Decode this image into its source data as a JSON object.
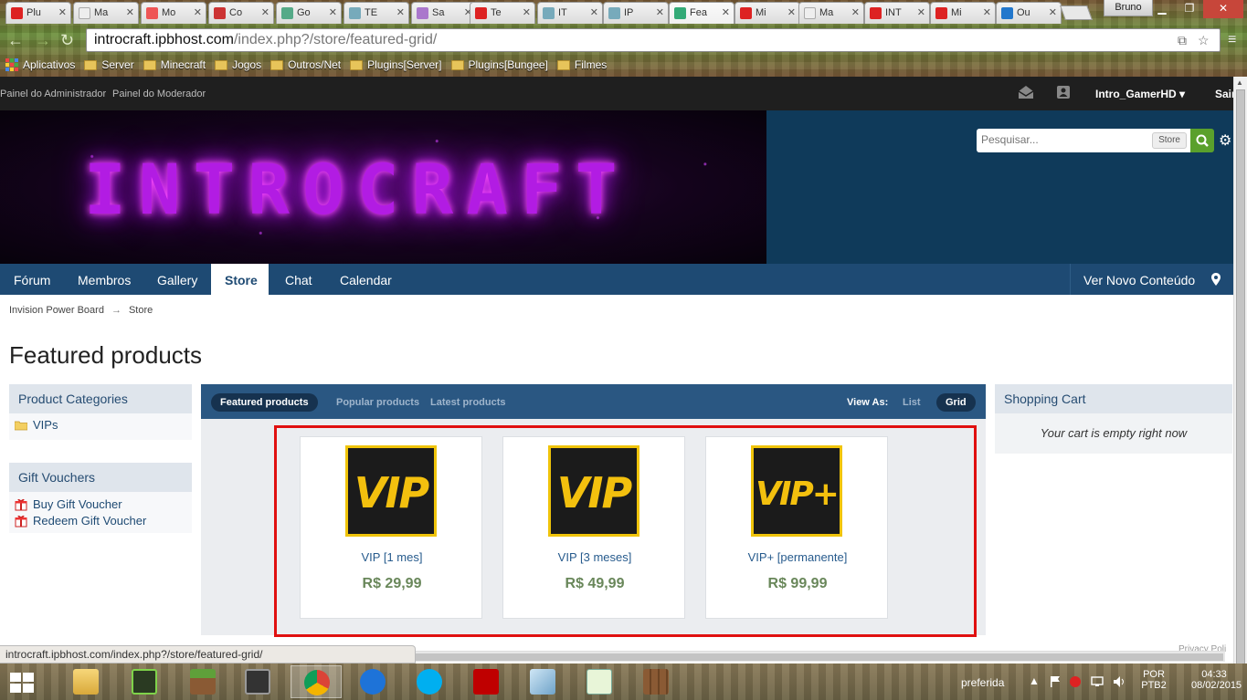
{
  "browser": {
    "tabs": [
      {
        "label": "Plu",
        "color": "#d22"
      },
      {
        "label": "Ma",
        "color": "#ddd"
      },
      {
        "label": "Mo",
        "color": "#e55"
      },
      {
        "label": "Co",
        "color": "#c33"
      },
      {
        "label": "Go",
        "color": "#5a8"
      },
      {
        "label": "TE",
        "color": "#7ab"
      },
      {
        "label": "Sa",
        "color": "#a7c"
      },
      {
        "label": "Te",
        "color": "#d22"
      },
      {
        "label": "IT",
        "color": "#7ab"
      },
      {
        "label": "IP",
        "color": "#7ab"
      },
      {
        "label": "Fea",
        "color": "#3a7"
      },
      {
        "label": "Mi",
        "color": "#d22"
      },
      {
        "label": "Ma",
        "color": "#ddd"
      },
      {
        "label": "INT",
        "color": "#d22"
      },
      {
        "label": "Mi",
        "color": "#d22"
      },
      {
        "label": "Ou",
        "color": "#27c"
      }
    ],
    "user": "Bruno",
    "url_host": "introcraft.ipbhost.com",
    "url_path": "/index.php?/store/featured-grid/",
    "bookmarks": [
      "Aplicativos",
      "Server",
      "Minecraft",
      "Jogos",
      "Outros/Net",
      "Plugins[Server]",
      "Plugins[Bungee]",
      "Filmes"
    ],
    "status_url": "introcraft.ipbhost.com/index.php?/store/featured-grid/"
  },
  "admin_bar": {
    "admin_panel": "Painel do Administrador",
    "mod_panel": "Painel do Moderador",
    "username": "Intro_GamerHD",
    "signout": "Sair"
  },
  "banner": {
    "logo_text": "INTROCRAFT",
    "search_placeholder": "Pesquisar...",
    "search_scope": "Store"
  },
  "nav": {
    "items": [
      "Fórum",
      "Membros",
      "Gallery",
      "Store",
      "Chat",
      "Calendar"
    ],
    "active": "Store",
    "new_content": "Ver Novo Conteúdo"
  },
  "breadcrumb": {
    "root": "Invision Power Board",
    "arrow": "→",
    "current": "Store"
  },
  "page_title": "Featured products",
  "sidebar": {
    "categories_title": "Product Categories",
    "categories": [
      "VIPs"
    ],
    "vouchers_title": "Gift Vouchers",
    "vouchers": [
      "Buy Gift Voucher",
      "Redeem Gift Voucher"
    ]
  },
  "products_panel": {
    "tabs": [
      "Featured products",
      "Popular products",
      "Latest products"
    ],
    "view_as": "View As:",
    "view_list": "List",
    "view_grid": "Grid",
    "items": [
      {
        "image_text": "VIP",
        "name": "VIP [1 mes]",
        "price": "R$ 29,99"
      },
      {
        "image_text": "VIP",
        "name": "VIP [3 meses]",
        "price": "R$ 49,99"
      },
      {
        "image_text": "VIP+",
        "name": "VIP+ [permanente]",
        "price": "R$ 99,99"
      }
    ]
  },
  "cart": {
    "title": "Shopping Cart",
    "empty": "Your cart is empty right now"
  },
  "footer_tag": "Privacy Poli",
  "taskbar": {
    "tray_label": "preferida",
    "lang": "POR",
    "layout": "PTB2",
    "time": "04:33",
    "date": "08/02/2015"
  }
}
